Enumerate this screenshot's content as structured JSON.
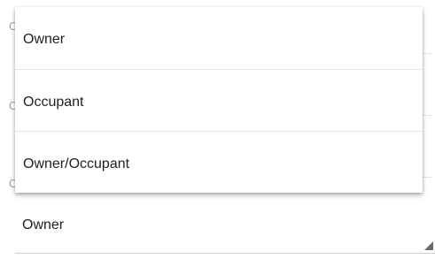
{
  "menu": {
    "items": [
      {
        "label": "Owner"
      },
      {
        "label": "Occupant"
      },
      {
        "label": "Owner/Occupant"
      }
    ]
  },
  "field": {
    "value": "Owner",
    "arrow_icon": "dropdown-corner-icon"
  },
  "colors": {
    "text": "#212121",
    "divider": "#e3e3e3",
    "background": "#ffffff"
  }
}
